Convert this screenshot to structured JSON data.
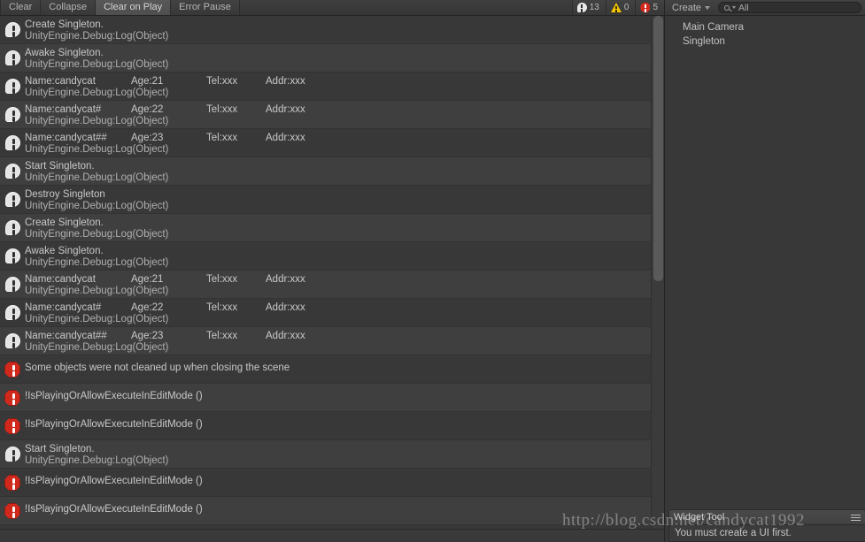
{
  "console": {
    "toolbar": {
      "clear_label": "Clear",
      "collapse_label": "Collapse",
      "clear_on_play_label": "Clear on Play",
      "error_pause_label": "Error Pause",
      "counters": {
        "info_count": "13",
        "warning_count": "0",
        "error_count": "5"
      },
      "icons": {
        "info": "info-speech-bubble-icon",
        "warning": "warning-triangle-icon",
        "error": "error-octagon-icon"
      }
    },
    "entries": [
      {
        "type": "info",
        "line1": "Create Singleton.",
        "line2": "UnityEngine.Debug:Log(Object)"
      },
      {
        "type": "info",
        "line1": "Awake Singleton.",
        "line2": "UnityEngine.Debug:Log(Object)"
      },
      {
        "type": "info",
        "cols": [
          "Name:candycat",
          "Age:21",
          "Tel:xxx",
          "Addr:xxx"
        ],
        "line2": "UnityEngine.Debug:Log(Object)"
      },
      {
        "type": "info",
        "cols": [
          "Name:candycat#",
          "Age:22",
          "Tel:xxx",
          "Addr:xxx"
        ],
        "line2": "UnityEngine.Debug:Log(Object)"
      },
      {
        "type": "info",
        "cols": [
          "Name:candycat##",
          "Age:23",
          "Tel:xxx",
          "Addr:xxx"
        ],
        "line2": "UnityEngine.Debug:Log(Object)"
      },
      {
        "type": "info",
        "line1": "Start Singleton.",
        "line2": "UnityEngine.Debug:Log(Object)"
      },
      {
        "type": "info",
        "line1": "Destroy Singleton",
        "line2": "UnityEngine.Debug:Log(Object)"
      },
      {
        "type": "info",
        "line1": "Create Singleton.",
        "line2": "UnityEngine.Debug:Log(Object)"
      },
      {
        "type": "info",
        "line1": "Awake Singleton.",
        "line2": "UnityEngine.Debug:Log(Object)"
      },
      {
        "type": "info",
        "cols": [
          "Name:candycat",
          "Age:21",
          "Tel:xxx",
          "Addr:xxx"
        ],
        "line2": "UnityEngine.Debug:Log(Object)"
      },
      {
        "type": "info",
        "cols": [
          "Name:candycat#",
          "Age:22",
          "Tel:xxx",
          "Addr:xxx"
        ],
        "line2": "UnityEngine.Debug:Log(Object)"
      },
      {
        "type": "info",
        "cols": [
          "Name:candycat##",
          "Age:23",
          "Tel:xxx",
          "Addr:xxx"
        ],
        "line2": "UnityEngine.Debug:Log(Object)"
      },
      {
        "type": "error",
        "line1": "Some objects were not cleaned up when closing the scene",
        "line2": ""
      },
      {
        "type": "error",
        "line1": "!IsPlayingOrAllowExecuteInEditMode ()",
        "line2": ""
      },
      {
        "type": "error",
        "line1": "!IsPlayingOrAllowExecuteInEditMode ()",
        "line2": ""
      },
      {
        "type": "info",
        "line1": "Start Singleton.",
        "line2": "UnityEngine.Debug:Log(Object)"
      },
      {
        "type": "error",
        "line1": "!IsPlayingOrAllowExecuteInEditMode ()",
        "line2": ""
      },
      {
        "type": "error",
        "line1": "!IsPlayingOrAllowExecuteInEditMode ()",
        "line2": ""
      }
    ]
  },
  "hierarchy": {
    "create_label": "Create",
    "search_value": "All",
    "items": [
      {
        "label": "Main Camera"
      },
      {
        "label": "Singleton"
      }
    ]
  },
  "widget_panel": {
    "title": "Widget Tool",
    "message": "You must create a UI first."
  },
  "watermark": {
    "text": "http://blog.csdn.net/candycat1992"
  },
  "colors": {
    "background": "#383838",
    "row_alt": "#3f3f3f",
    "error_red": "#d0291c",
    "warning_yellow": "#f2c400",
    "text": "#c8c8c8"
  }
}
